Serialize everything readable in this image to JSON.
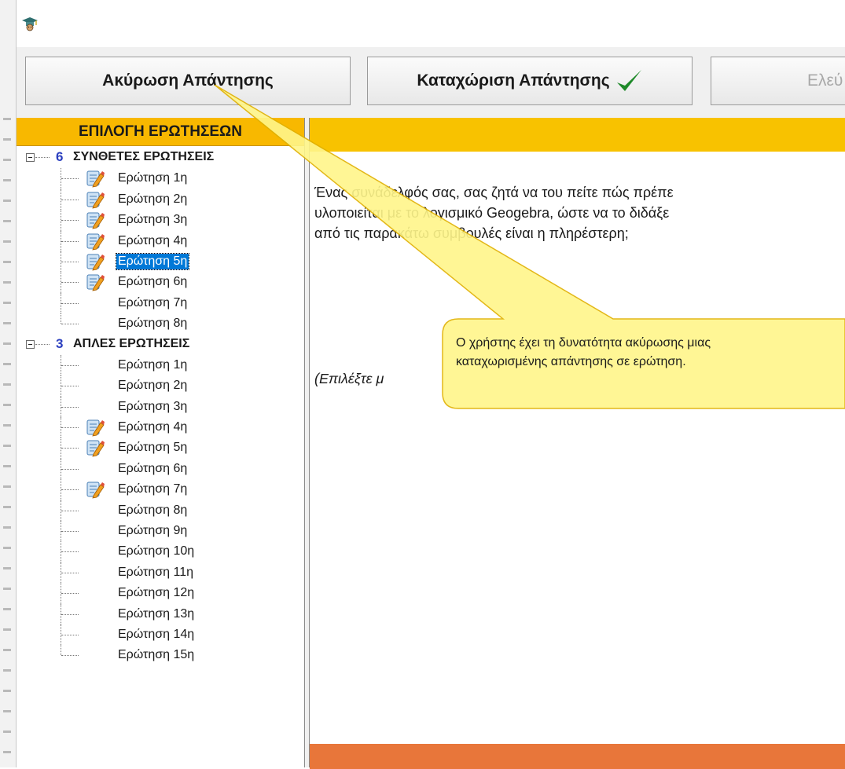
{
  "toolbar": {
    "cancel_label": "Ακύρωση Απάντησης",
    "submit_label": "Καταχώριση Απάντησης",
    "check_label": "Ελεύ"
  },
  "tree": {
    "header": "ΕΠΙΛΟΓΗ ΕΡΩΤΗΣΕΩΝ",
    "groups": [
      {
        "count": "6",
        "title": "ΣΥΝΘΕΤΕΣ ΕΡΩΤΗΣΕΙΣ",
        "items": [
          {
            "label": "Ερώτηση 1η",
            "answered": true
          },
          {
            "label": "Ερώτηση 2η",
            "answered": true
          },
          {
            "label": "Ερώτηση 3η",
            "answered": true
          },
          {
            "label": "Ερώτηση 4η",
            "answered": true
          },
          {
            "label": "Ερώτηση 5η",
            "answered": true,
            "selected": true
          },
          {
            "label": "Ερώτηση 6η",
            "answered": true
          },
          {
            "label": "Ερώτηση 7η",
            "answered": false
          },
          {
            "label": "Ερώτηση 8η",
            "answered": false
          }
        ]
      },
      {
        "count": "3",
        "title": "ΑΠΛΕΣ ΕΡΩΤΗΣΕΙΣ",
        "items": [
          {
            "label": "Ερώτηση 1η",
            "answered": false
          },
          {
            "label": "Ερώτηση 2η",
            "answered": false
          },
          {
            "label": "Ερώτηση 3η",
            "answered": false
          },
          {
            "label": "Ερώτηση 4η",
            "answered": true
          },
          {
            "label": "Ερώτηση 5η",
            "answered": true
          },
          {
            "label": "Ερώτηση 6η",
            "answered": false
          },
          {
            "label": "Ερώτηση 7η",
            "answered": true
          },
          {
            "label": "Ερώτηση 8η",
            "answered": false
          },
          {
            "label": "Ερώτηση 9η",
            "answered": false
          },
          {
            "label": "Ερώτηση 10η",
            "answered": false
          },
          {
            "label": "Ερώτηση 11η",
            "answered": false
          },
          {
            "label": "Ερώτηση 12η",
            "answered": false
          },
          {
            "label": "Ερώτηση 13η",
            "answered": false
          },
          {
            "label": "Ερώτηση 14η",
            "answered": false
          },
          {
            "label": "Ερώτηση 15η",
            "answered": false
          }
        ]
      }
    ]
  },
  "question": {
    "line1": "Ένας συνάδελφός σας, σας ζητά να του πείτε πώς πρέπε",
    "line2": "υλοποιείται με το λογισμικό Geogebra, ώστε να το διδάξε",
    "line3": "από τις παρακάτω συμβουλές είναι η πληρέστερη;",
    "instruction": "(Επιλέξτε μ"
  },
  "callout": {
    "line1": "Ο χρήστης έχει τη δυνατότητα ακύρωσης μιας",
    "line2": "καταχωρισμένης απάντησης σε ερώτηση."
  },
  "icons": {
    "app": "graduation-cap-icon",
    "answered": "notepad-pencil-icon",
    "check": "green-check-icon"
  },
  "colors": {
    "header_yellow": "#f8b800",
    "footer_orange": "#e8763a",
    "selection_blue": "#0078d7",
    "callout_fill": "#fff68a",
    "callout_border": "#e0b000",
    "count_blue": "#2b3fbf"
  }
}
